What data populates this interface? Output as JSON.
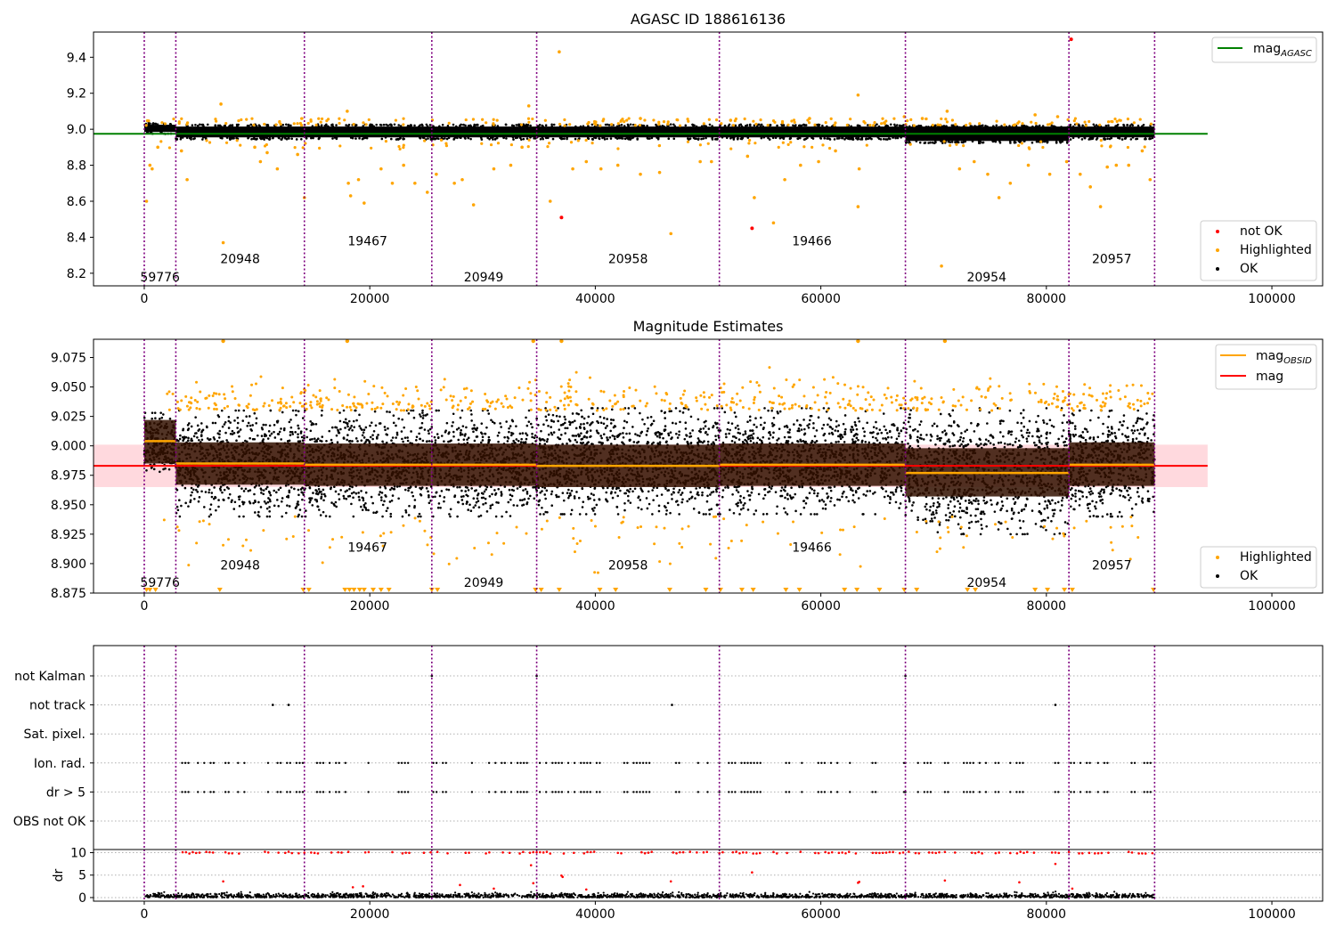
{
  "figure": {
    "background": "#ffffff",
    "colors": {
      "ok": "#000000",
      "highlighted": "#ffa500",
      "not_ok": "#ff0000",
      "obs_line": "#800080",
      "agasc_line": "#008000",
      "mag_line": "#ff0000",
      "mag_obsid_line": "#ffa500",
      "band": "#ffc0c8",
      "obs_band": "#321000",
      "grid": "#b0b0b0"
    }
  },
  "chart_data": [
    {
      "id": "agasc",
      "type": "scatter",
      "title": "AGASC ID 188616136",
      "xlim": [
        -4500,
        104500
      ],
      "ylim": [
        8.13,
        9.54
      ],
      "xticks": [
        0,
        20000,
        40000,
        60000,
        80000,
        100000
      ],
      "yticks": [
        8.2,
        8.4,
        8.6,
        8.8,
        9.0,
        9.2,
        9.4
      ],
      "ytick_labels": [
        "8.2",
        "8.4",
        "8.6",
        "8.8",
        "9.0",
        "9.2",
        "9.4"
      ],
      "obs_boundaries": [
        0,
        2800,
        14200,
        25500,
        34800,
        51000,
        67500,
        82000,
        89600
      ],
      "obs_labels": [
        {
          "text": "59776",
          "x": 1400,
          "y": 8.18
        },
        {
          "text": "20948",
          "x": 8500,
          "y": 8.28
        },
        {
          "text": "19467",
          "x": 19800,
          "y": 8.38
        },
        {
          "text": "20949",
          "x": 30100,
          "y": 8.18
        },
        {
          "text": "20958",
          "x": 42900,
          "y": 8.28
        },
        {
          "text": "19466",
          "x": 59200,
          "y": 8.38
        },
        {
          "text": "20954",
          "x": 74700,
          "y": 8.18
        },
        {
          "text": "20957",
          "x": 85800,
          "y": 8.28
        }
      ],
      "reference_line": {
        "name": "mag",
        "subscript": "AGASC",
        "y": 8.975,
        "x_range": [
          -4500,
          94300
        ]
      },
      "band_segments": [
        {
          "x0": 0,
          "x1": 2800,
          "lo": 8.985,
          "hi": 9.025
        },
        {
          "x0": 2800,
          "x1": 89600,
          "lo": 8.955,
          "hi": 9.015
        },
        {
          "x0": 67500,
          "x1": 82000,
          "lo": 8.935,
          "hi": 9.01
        }
      ],
      "highlighted_points": [
        [
          200,
          8.6
        ],
        [
          500,
          8.8
        ],
        [
          700,
          8.78
        ],
        [
          1200,
          8.9
        ],
        [
          3800,
          8.72
        ],
        [
          3300,
          8.88
        ],
        [
          6800,
          9.14
        ],
        [
          7000,
          8.37
        ],
        [
          9800,
          8.9
        ],
        [
          10300,
          8.82
        ],
        [
          10900,
          8.87
        ],
        [
          11800,
          8.78
        ],
        [
          13600,
          8.86
        ],
        [
          14200,
          8.62
        ],
        [
          18000,
          9.1
        ],
        [
          18100,
          8.7
        ],
        [
          18300,
          8.63
        ],
        [
          19000,
          8.72
        ],
        [
          19500,
          8.59
        ],
        [
          21000,
          8.78
        ],
        [
          22000,
          8.7
        ],
        [
          23000,
          8.8
        ],
        [
          24000,
          8.7
        ],
        [
          25100,
          8.65
        ],
        [
          25900,
          8.75
        ],
        [
          27500,
          8.7
        ],
        [
          28200,
          8.72
        ],
        [
          29200,
          8.58
        ],
        [
          31000,
          8.78
        ],
        [
          32500,
          8.8
        ],
        [
          33500,
          8.9
        ],
        [
          34100,
          9.13
        ],
        [
          36000,
          8.6
        ],
        [
          36800,
          9.43
        ],
        [
          38000,
          8.78
        ],
        [
          39200,
          8.82
        ],
        [
          40500,
          8.78
        ],
        [
          42000,
          8.8
        ],
        [
          44000,
          8.75
        ],
        [
          45700,
          8.76
        ],
        [
          46700,
          8.42
        ],
        [
          49300,
          8.82
        ],
        [
          50300,
          8.82
        ],
        [
          53500,
          8.85
        ],
        [
          54100,
          8.62
        ],
        [
          55800,
          8.48
        ],
        [
          56800,
          8.72
        ],
        [
          58200,
          8.8
        ],
        [
          59800,
          8.82
        ],
        [
          61300,
          8.88
        ],
        [
          63300,
          8.57
        ],
        [
          63400,
          8.78
        ],
        [
          63300,
          9.19
        ],
        [
          67400,
          9.07
        ],
        [
          70700,
          8.24
        ],
        [
          72300,
          8.78
        ],
        [
          73600,
          8.82
        ],
        [
          74800,
          8.75
        ],
        [
          75800,
          8.62
        ],
        [
          76800,
          8.7
        ],
        [
          78400,
          8.8
        ],
        [
          80300,
          8.75
        ],
        [
          81800,
          8.82
        ],
        [
          83000,
          8.75
        ],
        [
          83900,
          8.68
        ],
        [
          84800,
          8.57
        ],
        [
          85400,
          8.79
        ],
        [
          86200,
          8.8
        ],
        [
          87300,
          8.8
        ],
        [
          88500,
          8.88
        ],
        [
          89200,
          8.72
        ],
        [
          71200,
          9.1
        ],
        [
          69000,
          9.06
        ],
        [
          79000,
          9.08
        ],
        [
          81000,
          9.07
        ],
        [
          44000,
          9.06
        ],
        [
          52000,
          9.05
        ],
        [
          59000,
          9.06
        ]
      ],
      "not_ok_points": [
        [
          37000,
          8.51
        ],
        [
          53900,
          8.45
        ],
        [
          82200,
          9.5
        ]
      ],
      "legends": [
        {
          "position": "upper-right",
          "entries": [
            {
              "label": "mag",
              "subscript": "AGASC",
              "kind": "line",
              "color_key": "agasc_line"
            }
          ]
        },
        {
          "position": "lower-right",
          "entries": [
            {
              "label": "not OK",
              "kind": "dot",
              "color_key": "not_ok"
            },
            {
              "label": "Highlighted",
              "kind": "dot",
              "color_key": "highlighted"
            },
            {
              "label": "OK",
              "kind": "dot",
              "color_key": "ok"
            }
          ]
        }
      ]
    },
    {
      "id": "estimates",
      "type": "scatter",
      "title": "Magnitude Estimates",
      "xlim": [
        -4500,
        104500
      ],
      "ylim": [
        8.875,
        9.0905
      ],
      "xticks": [
        0,
        20000,
        40000,
        60000,
        80000,
        100000
      ],
      "yticks": [
        8.875,
        8.9,
        8.925,
        8.95,
        8.975,
        9.0,
        9.025,
        9.05,
        9.075
      ],
      "ytick_labels": [
        "8.875",
        "8.900",
        "8.925",
        "8.950",
        "8.975",
        "9.000",
        "9.025",
        "9.050",
        "9.075"
      ],
      "obs_boundaries": [
        0,
        2800,
        14200,
        25500,
        34800,
        51000,
        67500,
        82000,
        89600
      ],
      "obs_labels": [
        {
          "text": "59776",
          "x": 1400,
          "y": 8.884
        },
        {
          "text": "20948",
          "x": 8500,
          "y": 8.899
        },
        {
          "text": "19467",
          "x": 19800,
          "y": 8.914
        },
        {
          "text": "20949",
          "x": 30100,
          "y": 8.884
        },
        {
          "text": "20958",
          "x": 42900,
          "y": 8.899
        },
        {
          "text": "19466",
          "x": 59200,
          "y": 8.914
        },
        {
          "text": "20954",
          "x": 74700,
          "y": 8.884
        },
        {
          "text": "20957",
          "x": 85800,
          "y": 8.899
        }
      ],
      "mag_line": {
        "name": "mag",
        "y": 8.983,
        "x_range": [
          -4500,
          94300
        ],
        "band": [
          8.965,
          9.001
        ]
      },
      "obsid_segments": [
        {
          "x0": 0,
          "x1": 2800,
          "mag": 9.004,
          "lo": 8.985,
          "hi": 9.022
        },
        {
          "x0": 2800,
          "x1": 14200,
          "mag": 8.985,
          "lo": 8.967,
          "hi": 9.003
        },
        {
          "x0": 14200,
          "x1": 25500,
          "mag": 8.984,
          "lo": 8.966,
          "hi": 9.002
        },
        {
          "x0": 25500,
          "x1": 34800,
          "mag": 8.984,
          "lo": 8.966,
          "hi": 9.002
        },
        {
          "x0": 34800,
          "x1": 51000,
          "mag": 8.983,
          "lo": 8.965,
          "hi": 9.001
        },
        {
          "x0": 51000,
          "x1": 67500,
          "mag": 8.984,
          "lo": 8.966,
          "hi": 9.002
        },
        {
          "x0": 67500,
          "x1": 82000,
          "mag": 8.977,
          "lo": 8.957,
          "hi": 8.998
        },
        {
          "x0": 82000,
          "x1": 89600,
          "mag": 8.984,
          "lo": 8.966,
          "hi": 9.003
        }
      ],
      "scatter_envelope": [
        {
          "x0": 0,
          "x1": 2800,
          "lo": 8.978,
          "hi": 9.028
        },
        {
          "x0": 2800,
          "x1": 34800,
          "lo": 8.94,
          "hi": 9.03
        },
        {
          "x0": 34800,
          "x1": 67500,
          "lo": 8.942,
          "hi": 9.032
        },
        {
          "x0": 67500,
          "x1": 82000,
          "lo": 8.925,
          "hi": 9.032
        },
        {
          "x0": 82000,
          "x1": 89600,
          "lo": 8.94,
          "hi": 9.03
        }
      ],
      "outliers_below_axis_x": [
        200,
        500,
        1000,
        6700,
        14100,
        14600,
        17800,
        18200,
        18600,
        19100,
        19500,
        20300,
        21000,
        21700,
        25500,
        26000,
        34700,
        35200,
        36800,
        40400,
        41800,
        46600,
        49800,
        51100,
        53000,
        54000,
        56900,
        58100,
        62100,
        63200,
        65200,
        67400,
        68500,
        73000,
        73700,
        79000,
        80100,
        81600,
        82300,
        89500
      ],
      "legends": [
        {
          "position": "upper-right",
          "entries": [
            {
              "label": "mag",
              "subscript": "OBSID",
              "kind": "line",
              "color_key": "mag_obsid_line"
            },
            {
              "label": "mag",
              "kind": "line",
              "color_key": "mag_line"
            }
          ]
        },
        {
          "position": "lower-right",
          "entries": [
            {
              "label": "Highlighted",
              "kind": "dot",
              "color_key": "highlighted"
            },
            {
              "label": "OK",
              "kind": "dot",
              "color_key": "ok"
            }
          ]
        }
      ]
    },
    {
      "id": "flags",
      "type": "scatter",
      "title": "",
      "xlim": [
        -4500,
        104500
      ],
      "rows": [
        "not Kalman",
        "not track",
        "Sat. pixel.",
        "Ion. rad.",
        "dr > 5",
        "OBS not OK"
      ],
      "obs_boundaries": [
        0,
        2800,
        14200,
        25500,
        34800,
        51000,
        67500,
        82000,
        89600
      ],
      "flag_points": {
        "not Kalman": [
          25500,
          34800,
          67500
        ],
        "not track": [
          11400,
          12800,
          46800,
          80800
        ],
        "Sat. pixel.": [],
        "OBS not OK": []
      },
      "ion_rad_clusters": [
        [
          1400,
          1500
        ],
        [
          2800,
          6200
        ],
        [
          7200,
          9200
        ],
        [
          10700,
          14200
        ],
        [
          14200,
          18200
        ],
        [
          19600,
          20400
        ],
        [
          22000,
          23500
        ],
        [
          24800,
          26900
        ],
        [
          28500,
          29300
        ],
        [
          30300,
          34800
        ],
        [
          34800,
          40400
        ],
        [
          42000,
          45300
        ],
        [
          46600,
          50000
        ],
        [
          51000,
          55000
        ],
        [
          55800,
          58400
        ],
        [
          59500,
          63300
        ],
        [
          64300,
          67500
        ],
        [
          67500,
          70600
        ],
        [
          71000,
          76000
        ],
        [
          76800,
          79300
        ],
        [
          80500,
          83900
        ],
        [
          84300,
          85500
        ],
        [
          87000,
          89400
        ]
      ]
    },
    {
      "id": "dr",
      "type": "scatter",
      "title": "",
      "ylabel": "dr",
      "xlim": [
        -4500,
        104500
      ],
      "ylim": [
        -0.8,
        10.7
      ],
      "xticks": [
        0,
        20000,
        40000,
        60000,
        80000,
        100000
      ],
      "xtick_labels": [
        "0",
        "20000",
        "40000",
        "60000",
        "80000",
        "100000"
      ],
      "yticks": [
        0,
        5,
        10
      ],
      "ytick_labels": [
        "0",
        "5",
        "10"
      ],
      "obs_boundaries": [
        0,
        2800,
        14200,
        25500,
        34800,
        51000,
        67500,
        82000,
        89600
      ],
      "dr_extra_points": [
        [
          7000,
          3.6
        ],
        [
          34300,
          7.2
        ],
        [
          34500,
          3.2
        ],
        [
          37000,
          4.9
        ],
        [
          37100,
          4.6
        ],
        [
          39200,
          1.8
        ],
        [
          46700,
          3.6
        ],
        [
          53900,
          5.6
        ],
        [
          63300,
          3.3
        ],
        [
          63400,
          3.5
        ],
        [
          71000,
          3.8
        ],
        [
          77600,
          3.4
        ],
        [
          80800,
          7.5
        ],
        [
          82300,
          2.0
        ],
        [
          18500,
          2.3
        ],
        [
          19400,
          2.5
        ],
        [
          28000,
          2.8
        ],
        [
          31000,
          2.0
        ]
      ]
    }
  ]
}
